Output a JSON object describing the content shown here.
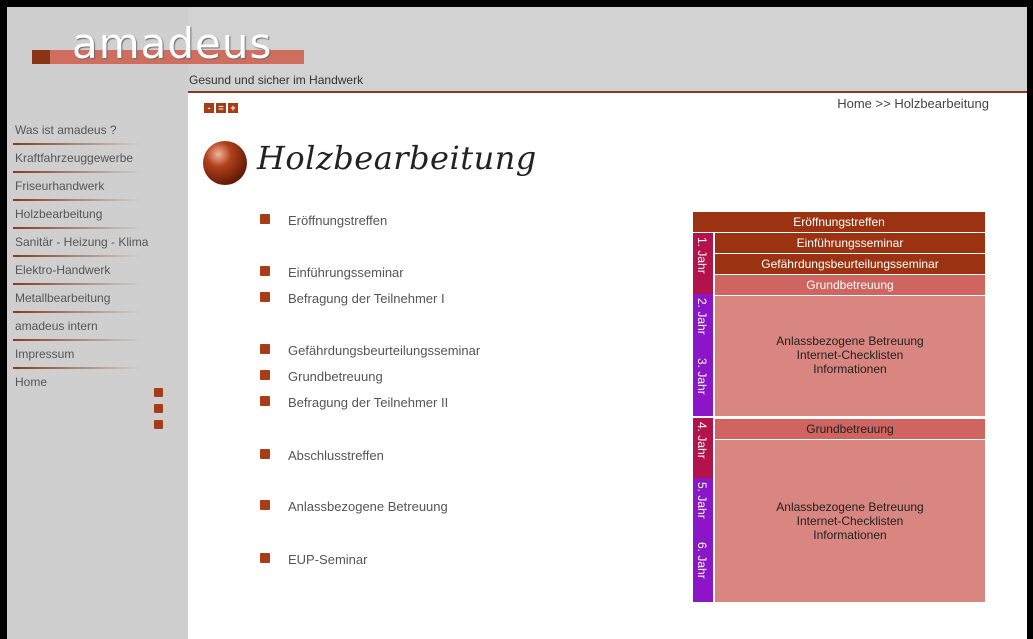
{
  "logo": {
    "text": "amadeus",
    "tagline": "Gesund und sicher im Handwerk"
  },
  "sidebar": {
    "items": [
      {
        "label": "Was ist amadeus ?"
      },
      {
        "label": "Kraftfahrzeuggewerbe"
      },
      {
        "label": "Friseurhandwerk"
      },
      {
        "label": "Holzbearbeitung"
      },
      {
        "label": "Sanitär - Heizung - Klima"
      },
      {
        "label": "Elektro-Handwerk"
      },
      {
        "label": "Metallbearbeitung"
      },
      {
        "label": "amadeus intern"
      },
      {
        "label": "Impressum"
      },
      {
        "label": "Home"
      }
    ]
  },
  "breadcrumb": "Home >> Holzbearbeitung",
  "font_size_buttons": [
    "-",
    "=",
    "+"
  ],
  "page_title": "Holzbearbeitung",
  "steps": [
    "Eröffnungstreffen",
    "Einführungsseminar",
    "Befragung der Teilnehmer I",
    "Gefährdungsbeurteilungsseminar",
    "Grundbetreuung",
    "Befragung der Teilnehmer II",
    "Abschlusstreffen",
    "Anlassbezogene Betreuung",
    "EUP-Seminar"
  ],
  "schedule": {
    "top": "Eröffnungstreffen",
    "einf": "Einführungsseminar",
    "gef": "Gefährdungsbeurteilungsseminar",
    "grund1": "Grundbetreuung",
    "block1": [
      "Anlassbezogene Betreuung",
      "Internet-Checklisten",
      "Informationen"
    ],
    "grund2": "Grundbetreuung",
    "block2": [
      "Anlassbezogene Betreuung",
      "Internet-Checklisten",
      "Informationen"
    ],
    "years": [
      "1. Jahr",
      "2. Jahr",
      "3. Jahr",
      "4. Jahr",
      "5. Jahr",
      "6. Jahr"
    ],
    "colors": {
      "dark": "#9b3312",
      "mid": "#cf6460",
      "light": "#d98580",
      "year1": "#b3124a",
      "year_purple": "#8a16c7"
    }
  }
}
